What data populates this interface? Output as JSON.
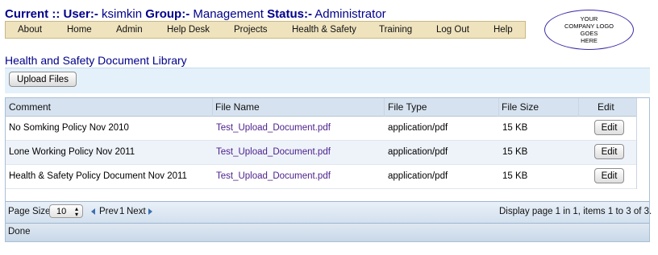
{
  "header": {
    "current_label": "Current ::",
    "user_label": "User:-",
    "user_value": "ksimkin",
    "group_label": "Group:-",
    "group_value": "Management",
    "status_label": "Status:-",
    "status_value": "Administrator"
  },
  "logo": {
    "line1": "YOUR",
    "line2": "COMPANY LOGO",
    "line3": "GOES",
    "line4": "HERE"
  },
  "nav": {
    "items": [
      "About",
      "Home",
      "Admin",
      "Help Desk",
      "Projects",
      "Health & Safety",
      "Training",
      "Log Out",
      "Help"
    ]
  },
  "page": {
    "title": "Health and Safety Document Library"
  },
  "upload": {
    "button_label": "Upload Files"
  },
  "table": {
    "columns": [
      "Comment",
      "File Name",
      "File Type",
      "File Size",
      "Edit"
    ],
    "rows": [
      {
        "comment": "No Somking Policy Nov 2010",
        "file_name": "Test_Upload_Document.pdf",
        "file_type": "application/pdf",
        "file_size": "15 KB",
        "edit": "Edit"
      },
      {
        "comment": "Lone Working Policy Nov 2011",
        "file_name": "Test_Upload_Document.pdf",
        "file_type": "application/pdf",
        "file_size": "15 KB",
        "edit": "Edit"
      },
      {
        "comment": "Health & Safety Policy Document Nov 2011",
        "file_name": "Test_Upload_Document.pdf",
        "file_type": "application/pdf",
        "file_size": "15 KB",
        "edit": "Edit"
      }
    ]
  },
  "pager": {
    "page_size_label": "Page Size:",
    "page_size_value": "10",
    "prev_label": "Prev",
    "current_page": "1",
    "next_label": "Next",
    "display_text": "Display page 1 in 1, items 1 to 3 of 3."
  },
  "status": {
    "text": "Done"
  },
  "colors": {
    "header_text": "#00008b",
    "nav_bg": "#efe3be",
    "link": "#4b1f8a",
    "grid_header_bg": "#d6e2ef",
    "alt_row_bg": "#eef3fa"
  }
}
